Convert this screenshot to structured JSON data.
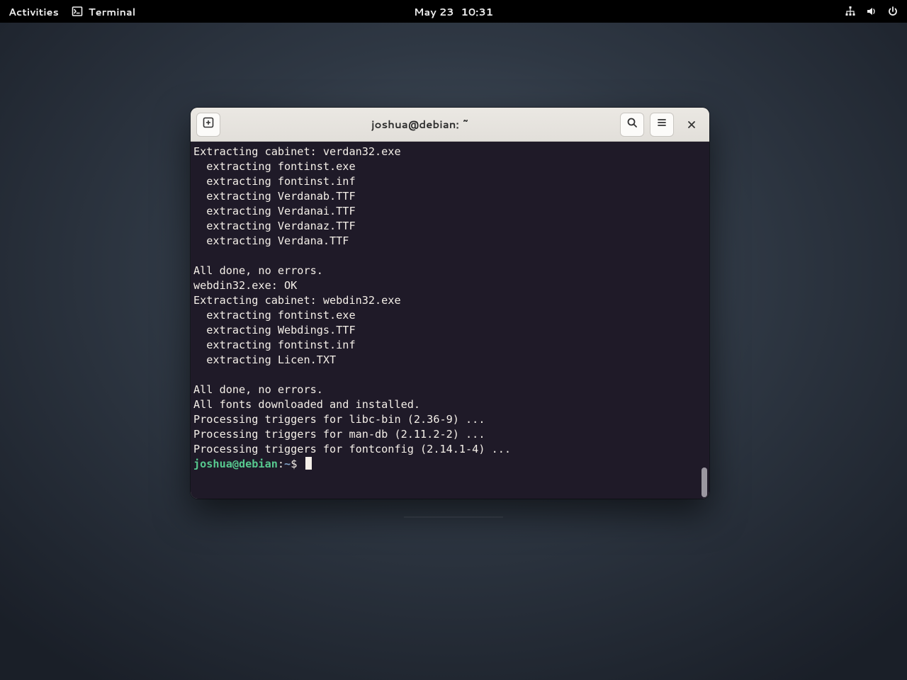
{
  "topbar": {
    "activities": "Activities",
    "app_name": "Terminal",
    "date": "May 23",
    "time": "10:31"
  },
  "window": {
    "title": "joshua@debian: ~"
  },
  "terminal": {
    "lines": [
      "Extracting cabinet: verdan32.exe",
      "  extracting fontinst.exe",
      "  extracting fontinst.inf",
      "  extracting Verdanab.TTF",
      "  extracting Verdanai.TTF",
      "  extracting Verdanaz.TTF",
      "  extracting Verdana.TTF",
      "",
      "All done, no errors.",
      "webdin32.exe: OK",
      "Extracting cabinet: webdin32.exe",
      "  extracting fontinst.exe",
      "  extracting Webdings.TTF",
      "  extracting fontinst.inf",
      "  extracting Licen.TXT",
      "",
      "All done, no errors.",
      "All fonts downloaded and installed.",
      "Processing triggers for libc-bin (2.36-9) ...",
      "Processing triggers for man-db (2.11.2-2) ...",
      "Processing triggers for fontconfig (2.14.1-4) ..."
    ],
    "prompt": {
      "user_host": "joshua@debian",
      "sep": ":",
      "path": "~",
      "symbol": "$"
    }
  }
}
